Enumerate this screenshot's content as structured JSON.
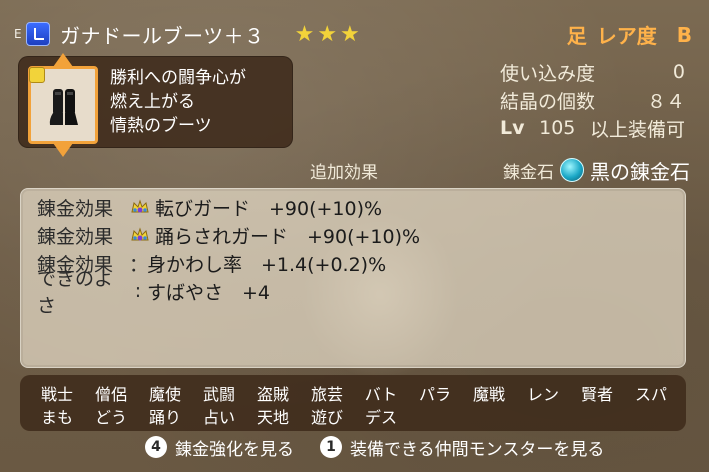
{
  "header": {
    "e_mark": "E",
    "item_name": "ガナドールブーツ＋３",
    "stars": "★★★",
    "rarity_kanji": "足",
    "rarity_label": "レア度",
    "rarity_grade": "B"
  },
  "description": {
    "lines": [
      "勝利への闘争心が",
      "燃え上がる",
      "情熱のブーツ"
    ]
  },
  "stats": {
    "usage_label": "使い込み度",
    "usage_value": "0",
    "crystals_label": "結晶の個数",
    "crystals_value": "８４",
    "lv_prefix": "Lv",
    "lv_value": "105",
    "lv_suffix": "以上装備可"
  },
  "effects_header": {
    "added_effects": "追加効果",
    "stone_label": "錬金石",
    "stone_name": "黒の錬金石"
  },
  "effects": [
    {
      "key": "錬金効果",
      "text": "転びガード　+90(+10)%"
    },
    {
      "key": "錬金効果",
      "text": "踊らされガード　+90(+10)%"
    },
    {
      "key": "錬金効果",
      "colon": "：",
      "text": "身かわし率　+1.4(+0.2)%"
    },
    {
      "key": "できのよさ",
      "colon": ":",
      "text": "すばやさ　+4"
    }
  ],
  "jobs": {
    "row1": [
      "戦士",
      "僧侶",
      "魔使",
      "武闘",
      "盗賊",
      "旅芸",
      "バト",
      "パラ",
      "魔戦",
      "レン",
      "賢者",
      "スパ"
    ],
    "row2": [
      "まも",
      "どう",
      "踊り",
      "占い",
      "天地",
      "遊び",
      "デス"
    ]
  },
  "footer": {
    "btn4_number": "4",
    "btn4_label": "錬金強化を見る",
    "btn1_number": "1",
    "btn1_label": "装備できる仲間モンスターを見る"
  },
  "colors": {
    "accent_orange": "#f2a23a",
    "star_yellow": "#f2d33a",
    "rarity_orange": "#ffb24a"
  }
}
